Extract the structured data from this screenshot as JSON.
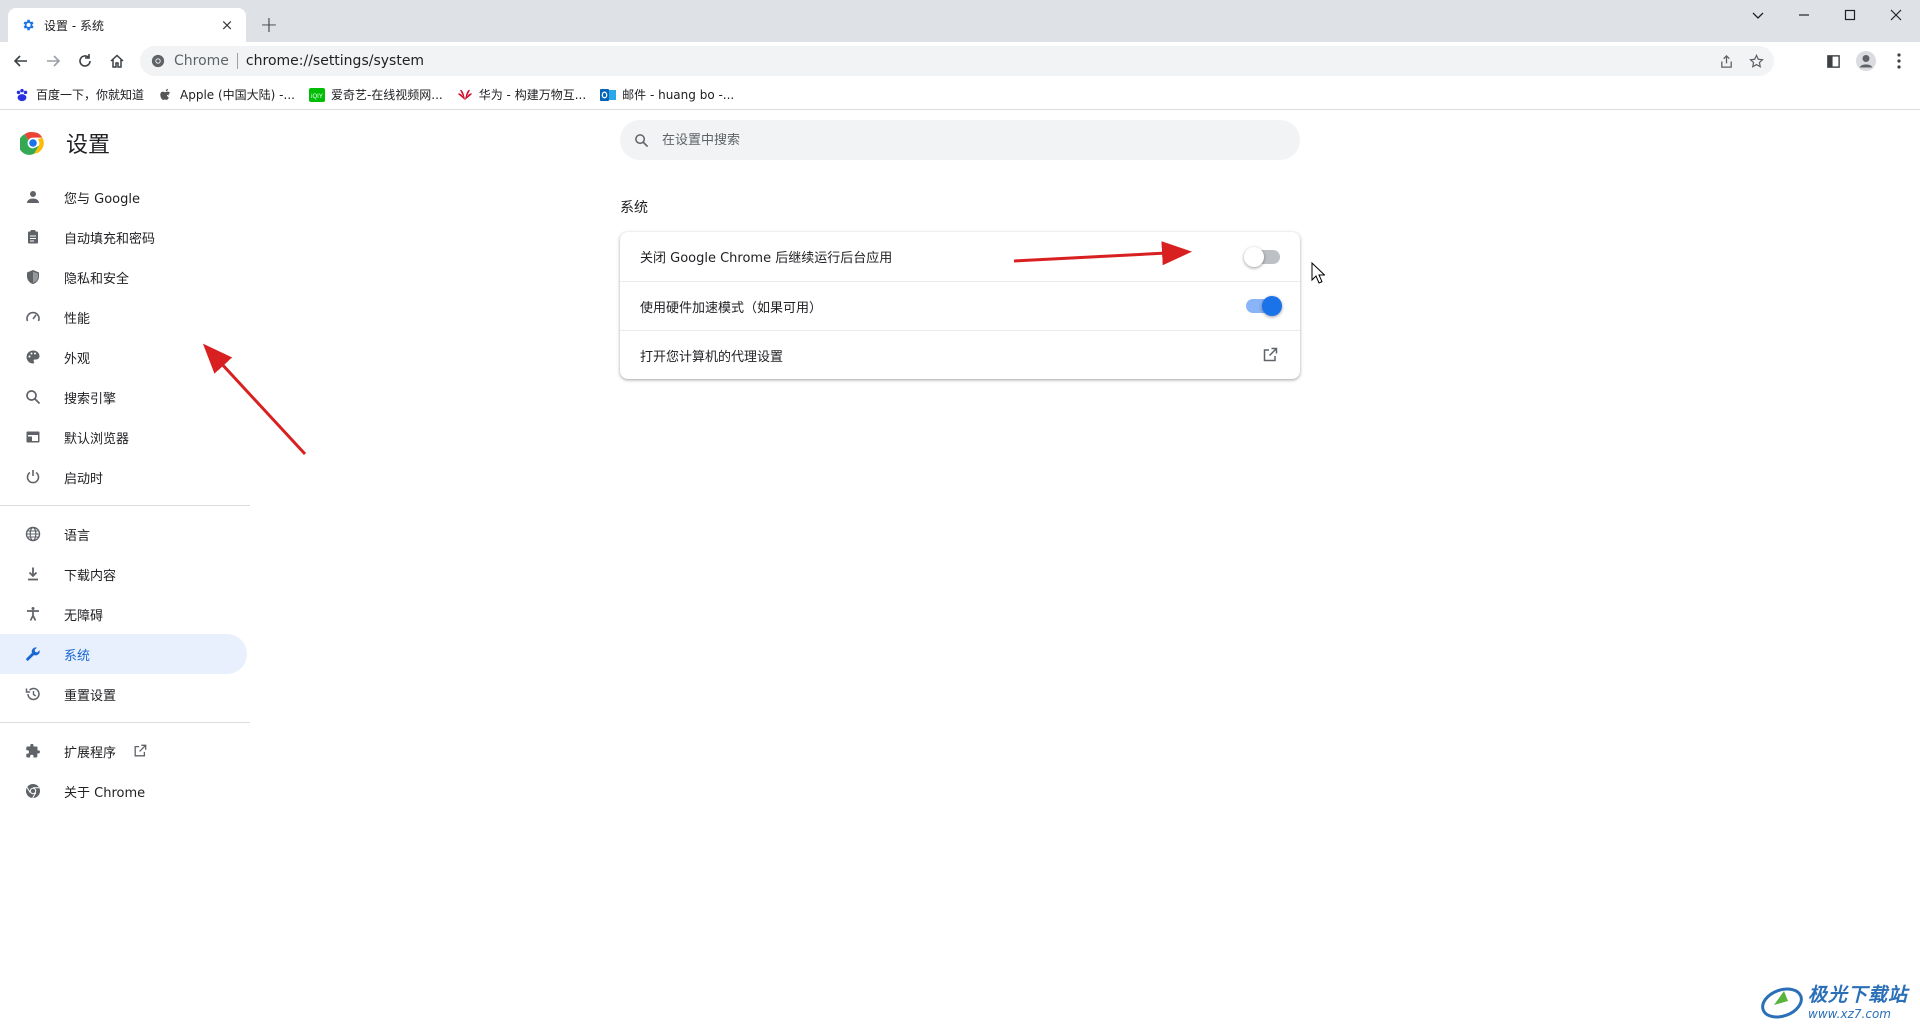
{
  "browser": {
    "tab": {
      "title": "设置 - 系统",
      "close": "×"
    },
    "new_tab": "+",
    "omnibox": {
      "origin": "Chrome",
      "url": "chrome://settings/system"
    },
    "bookmarks": [
      {
        "label": "百度一下，你就知道",
        "icon": "baidu-icon"
      },
      {
        "label": "Apple (中国大陆) -...",
        "icon": "apple-icon"
      },
      {
        "label": "爱奇艺-在线视频网...",
        "icon": "iqiyi-icon"
      },
      {
        "label": "华为 - 构建万物互...",
        "icon": "huawei-icon"
      },
      {
        "label": "邮件 - huang bo -...",
        "icon": "outlook-icon"
      }
    ]
  },
  "settings": {
    "title": "设置",
    "search_placeholder": "在设置中搜索",
    "nav": [
      {
        "label": "您与 Google",
        "icon": "person-icon"
      },
      {
        "label": "自动填充和密码",
        "icon": "clipboard-icon"
      },
      {
        "label": "隐私和安全",
        "icon": "shield-icon"
      },
      {
        "label": "性能",
        "icon": "speedometer-icon"
      },
      {
        "label": "外观",
        "icon": "palette-icon"
      },
      {
        "label": "搜索引擎",
        "icon": "search-icon"
      },
      {
        "label": "默认浏览器",
        "icon": "browser-icon"
      },
      {
        "label": "启动时",
        "icon": "power-icon"
      },
      {
        "label": "语言",
        "icon": "globe-icon"
      },
      {
        "label": "下载内容",
        "icon": "download-icon"
      },
      {
        "label": "无障碍",
        "icon": "accessibility-icon"
      },
      {
        "label": "系统",
        "icon": "wrench-icon",
        "active": true
      },
      {
        "label": "重置设置",
        "icon": "history-icon"
      },
      {
        "label": "扩展程序",
        "icon": "puzzle-icon"
      },
      {
        "label": "关于 Chrome",
        "icon": "chrome-icon"
      }
    ],
    "section": {
      "title": "系统",
      "rows": [
        {
          "label": "关闭 Google Chrome 后继续运行后台应用",
          "control": "toggle",
          "checked": false
        },
        {
          "label": "使用硬件加速模式（如果可用）",
          "control": "toggle",
          "checked": true
        },
        {
          "label": "打开您计算机的代理设置",
          "control": "external-link"
        }
      ]
    }
  },
  "watermark": {
    "name": "极光下载站",
    "url": "www.xz7.com"
  },
  "colors": {
    "accent": "#1a73e8",
    "active_nav_bg": "#e8f0fe",
    "annotation_arrow": "#d92020"
  }
}
